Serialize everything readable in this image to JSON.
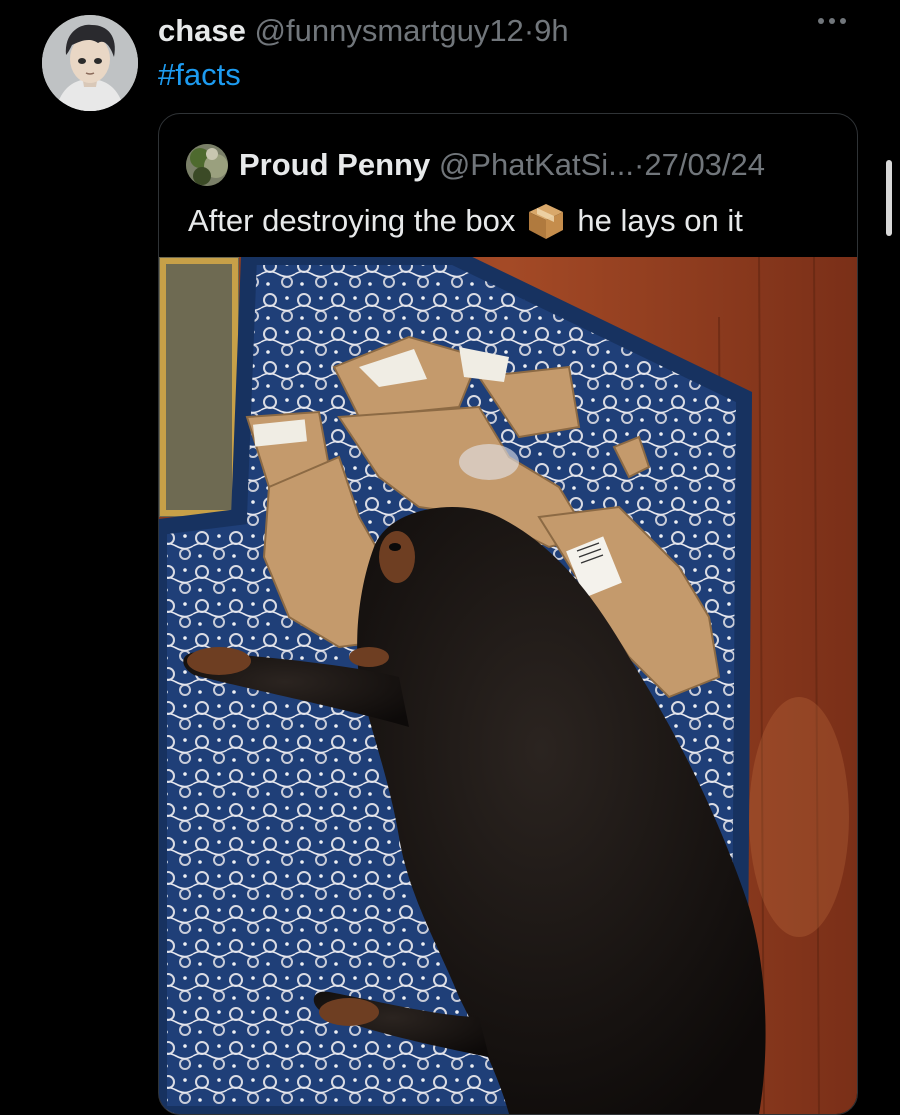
{
  "tweet": {
    "display_name": "chase",
    "handle": "@funnysmartguy12",
    "separator": "·",
    "time": "9h",
    "text": "#facts",
    "avatar_icon": "anime-boy-avatar-icon",
    "more_icon": "more-options-icon"
  },
  "quoted": {
    "display_name": "Proud Penny",
    "handle": "@PhatKatSi...",
    "separator": "·",
    "date": "27/03/24",
    "text_before": "After destroying the box",
    "emoji_icon": "package-box-icon",
    "text_after": "he lays on it",
    "photo_description_icon": "photo-dog-on-cardboard"
  },
  "colors": {
    "background": "#000000",
    "primary_text": "#e7e9ea",
    "secondary_text": "#71767b",
    "link": "#1d9bf0",
    "border": "#2f3336"
  }
}
